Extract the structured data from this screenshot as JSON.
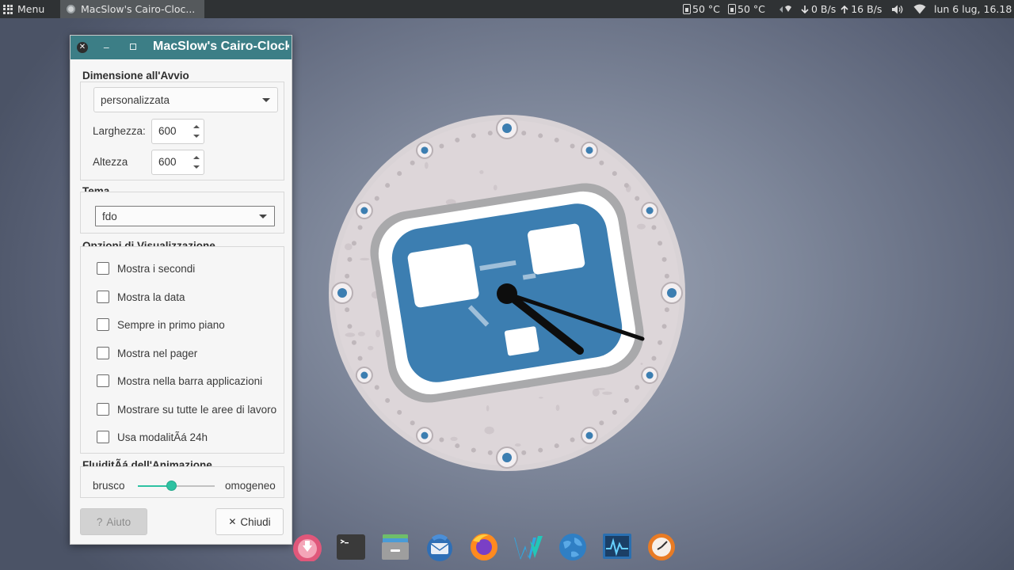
{
  "top_panel": {
    "menu_label": "Menu",
    "task_label": "MacSlow's Cairo-Cloc...",
    "temp1": "50 °C",
    "temp2": "50 °C",
    "net_down": "0 B/s",
    "net_up": "16 B/s",
    "datetime": "lun  6 lug, 16.18",
    "icons": [
      "menu-grid-icon",
      "thermometer-icon",
      "network-icon",
      "download-arrow-icon",
      "upload-arrow-icon",
      "volume-icon",
      "wifi-icon"
    ]
  },
  "window": {
    "title": "MacSlow's Cairo-Clock -...",
    "startup_size": {
      "section_title": "Dimensione all'Avvio",
      "preset_value": "personalizzata",
      "width_label": "Larghezza:",
      "width_value": "600",
      "height_label": "Altezza",
      "height_value": "600"
    },
    "theme": {
      "section_title": "Tema",
      "value": "fdo"
    },
    "display_options": {
      "section_title": "Opzioni di Visualizzazione",
      "items": [
        {
          "label": "Mostra i secondi",
          "checked": false
        },
        {
          "label": "Mostra la data",
          "checked": false
        },
        {
          "label": "Sempre in primo piano",
          "checked": false
        },
        {
          "label": "Mostra nel pager",
          "checked": false
        },
        {
          "label": "Mostra nella barra applicazioni",
          "checked": false
        },
        {
          "label": "Mostrare su tutte le aree di lavoro",
          "checked": false
        },
        {
          "label": "Usa modalitÃá 24h",
          "checked": false
        }
      ]
    },
    "animation": {
      "section_title": "FluiditÃá dell'Animazione",
      "min_label": "brusco",
      "max_label": "omogeneo",
      "value_fraction": 0.43
    },
    "help_label": "Aiuto",
    "close_label": "Chiudi"
  },
  "colors": {
    "titlebar": "#3c7e86",
    "accent": "#2ec2a2",
    "clock_face": "#3c7eb1"
  },
  "dock": {
    "icons": [
      "downloader-icon",
      "terminal-icon",
      "file-manager-icon",
      "mail-client-icon",
      "firefox-icon",
      "code-editor-icon",
      "web-browser-icon",
      "system-monitor-icon",
      "clock-app-icon"
    ]
  }
}
